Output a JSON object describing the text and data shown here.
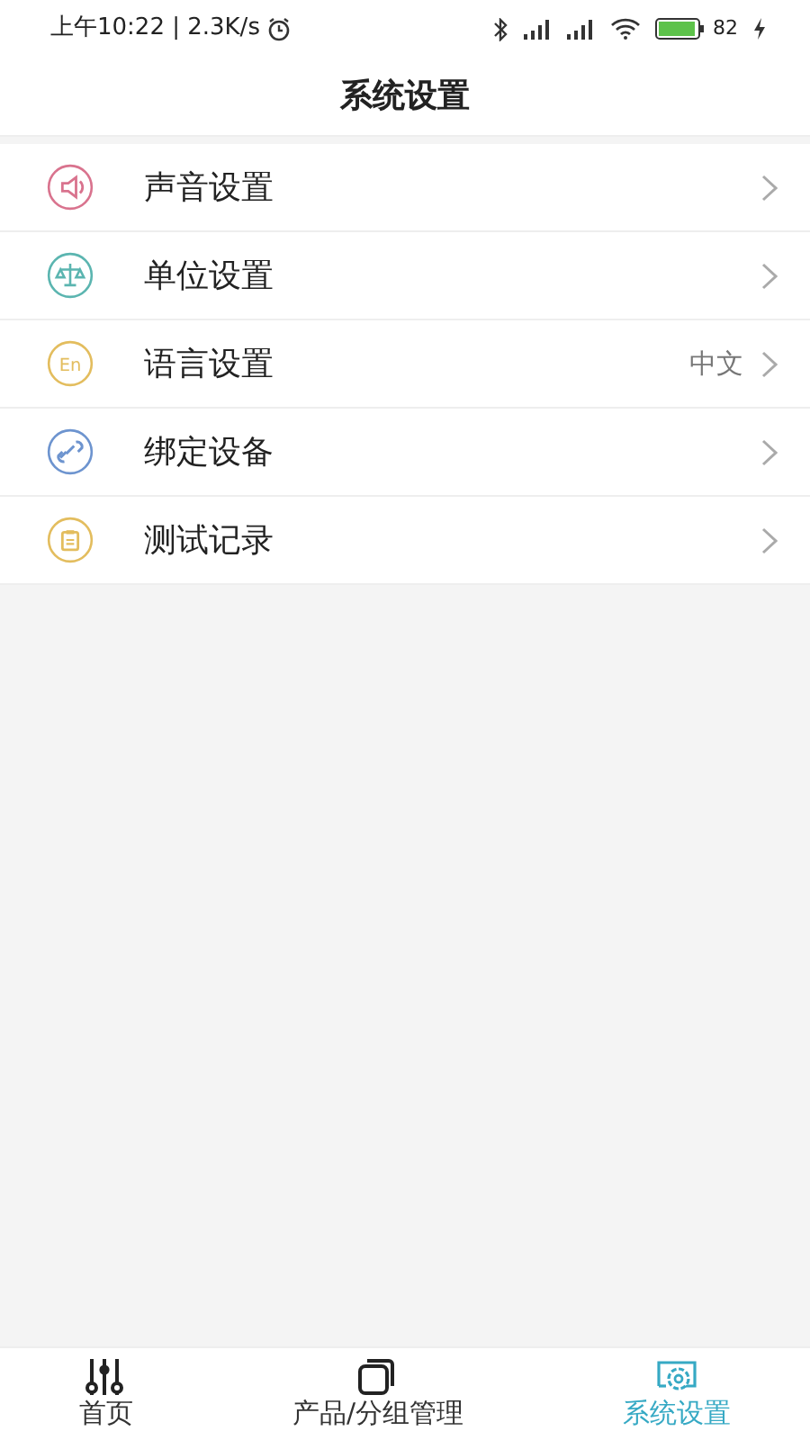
{
  "status_bar": {
    "time": "上午10:22 | 2.3K/s",
    "battery": "82"
  },
  "header": {
    "title": "系统设置"
  },
  "settings": [
    {
      "kind": "sound",
      "label": "声音设置",
      "color": "#d9738e"
    },
    {
      "kind": "unit",
      "label": "单位设置",
      "color": "#5bb5b0"
    },
    {
      "kind": "language",
      "label": "语言设置",
      "color": "#e3bd5e",
      "icon_text": "En",
      "value": "中文"
    },
    {
      "kind": "bind",
      "label": "绑定设备",
      "color": "#6d94cf"
    },
    {
      "kind": "record",
      "label": "测试记录",
      "color": "#e3bd5e"
    }
  ],
  "tabs": [
    {
      "kind": "home",
      "label": "首页",
      "selected": false
    },
    {
      "kind": "products",
      "label": "产品/分组管理",
      "selected": false
    },
    {
      "kind": "settings",
      "label": "系统设置",
      "selected": true
    }
  ]
}
